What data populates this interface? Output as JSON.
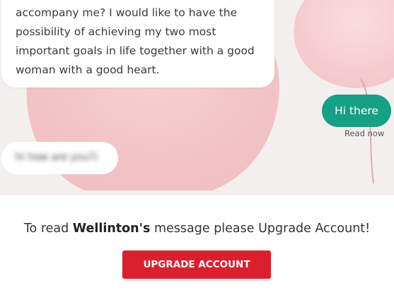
{
  "chat": {
    "incoming_message": "accompany me? I would like to have the possibility of achieving my two most important goals in life together with a good woman with a good heart.",
    "outgoing_message": "Hi there",
    "read_status": "Read now",
    "blurred_message": "hi how are you?)"
  },
  "upgrade": {
    "prefix": "To read ",
    "sender_name": "Wellinton's",
    "suffix": " message please Upgrade Account!",
    "button_label": "UPGRADE ACCOUNT"
  },
  "colors": {
    "outgoing_bubble": "#16a085",
    "upgrade_button": "#d9202f",
    "chat_background": "#f3efef"
  }
}
